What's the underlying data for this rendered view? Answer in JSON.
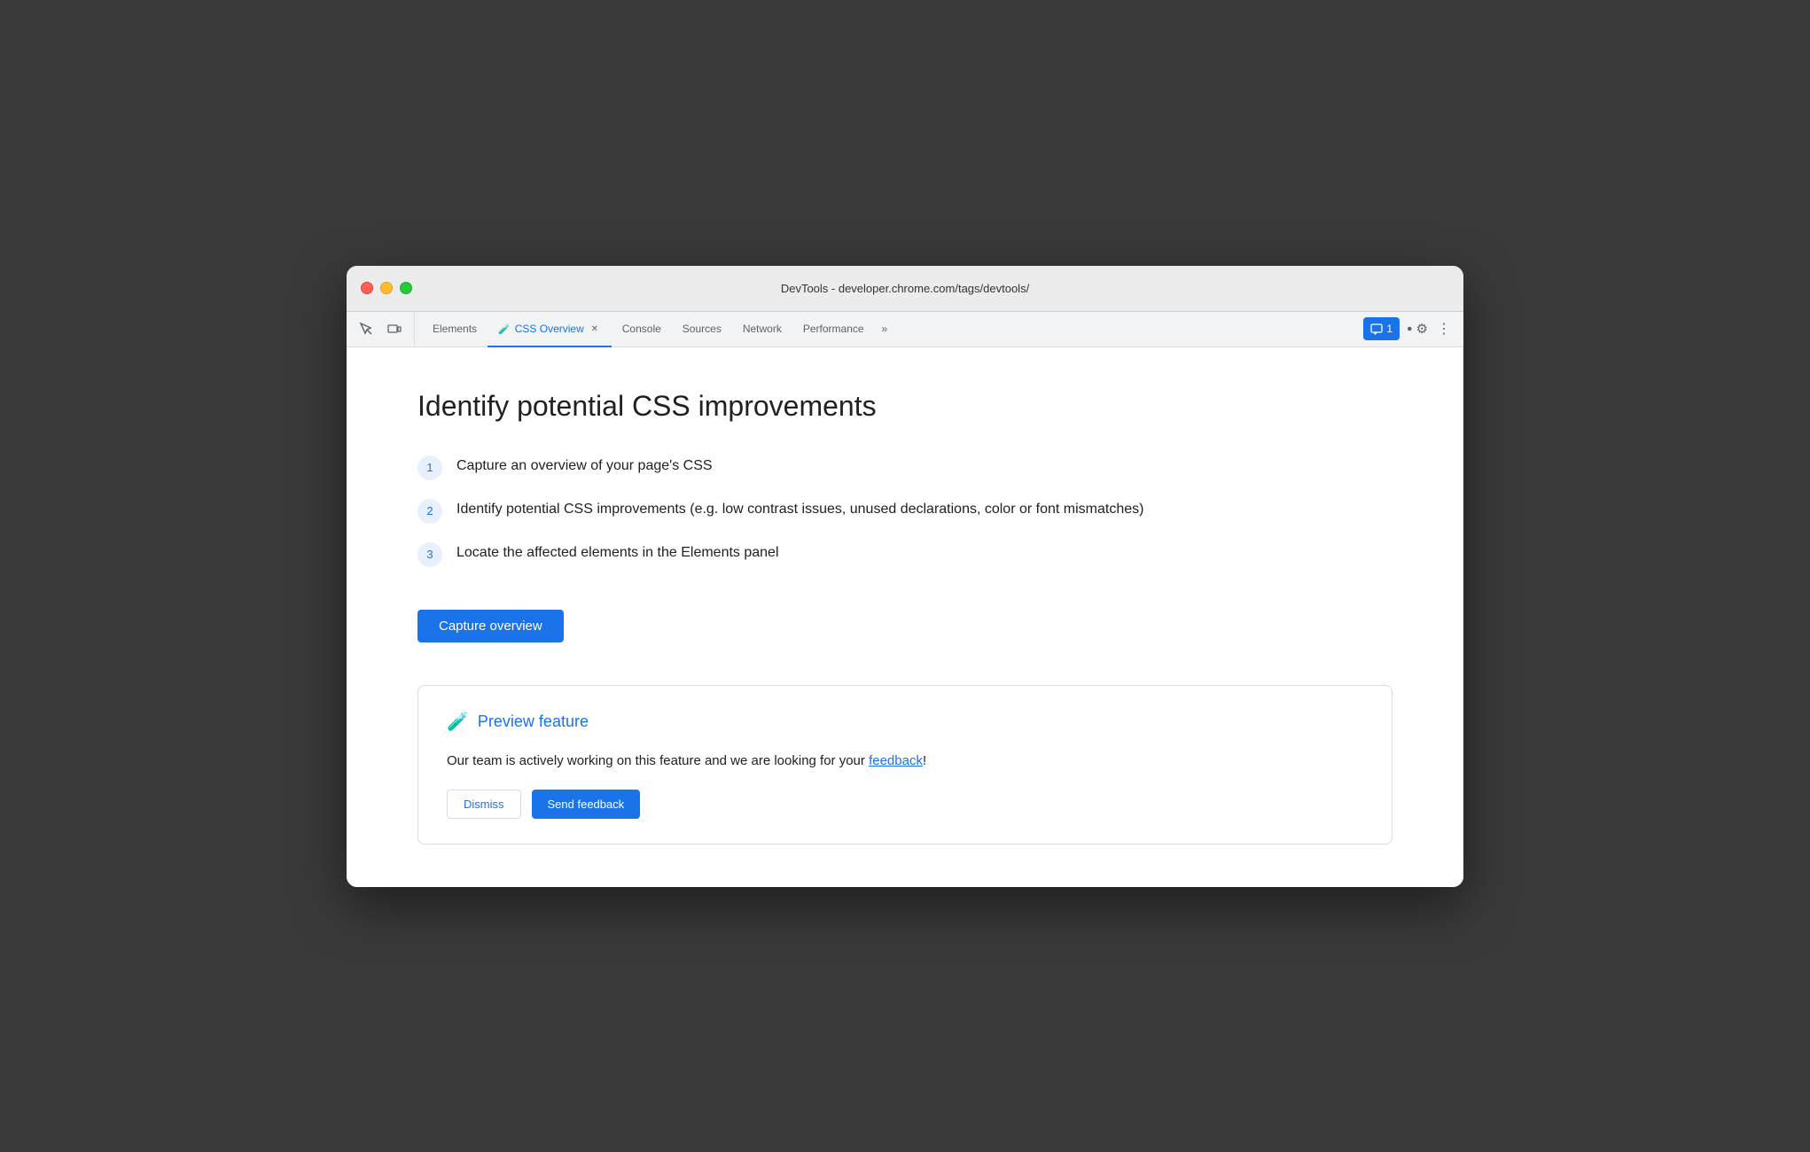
{
  "window": {
    "title": "DevTools - developer.chrome.com/tags/devtools/"
  },
  "traffic_lights": {
    "red_label": "close",
    "yellow_label": "minimize",
    "green_label": "maximize"
  },
  "toolbar": {
    "inspect_icon": "⬚",
    "device_icon": "❒",
    "tabs": [
      {
        "id": "elements",
        "label": "Elements",
        "active": false,
        "closable": false
      },
      {
        "id": "css-overview",
        "label": "CSS Overview",
        "active": true,
        "closable": true,
        "has_flask": true
      },
      {
        "id": "console",
        "label": "Console",
        "active": false,
        "closable": false
      },
      {
        "id": "sources",
        "label": "Sources",
        "active": false,
        "closable": false
      },
      {
        "id": "network",
        "label": "Network",
        "active": false,
        "closable": false
      },
      {
        "id": "performance",
        "label": "Performance",
        "active": false,
        "closable": false
      }
    ],
    "more_tabs_label": "»",
    "messages_count": "1",
    "settings_icon": "⚙",
    "more_icon": "⋮"
  },
  "main": {
    "heading": "Identify potential CSS improvements",
    "steps": [
      {
        "number": "1",
        "text": "Capture an overview of your page's CSS"
      },
      {
        "number": "2",
        "text": "Identify potential CSS improvements (e.g. low contrast issues, unused declarations, color or font mismatches)"
      },
      {
        "number": "3",
        "text": "Locate the affected elements in the Elements panel"
      }
    ],
    "capture_button_label": "Capture overview",
    "preview": {
      "title": "Preview feature",
      "body_prefix": "Our team is actively working on this feature and we are looking for your ",
      "feedback_link_text": "feedback",
      "body_suffix": "!",
      "btn1_label": "Dismiss",
      "btn2_label": "Send feedback"
    }
  },
  "colors": {
    "accent_blue": "#1a73e8",
    "step_circle_bg": "#e8f0fe",
    "step_circle_text": "#1a73e8",
    "border": "#dadce0"
  }
}
